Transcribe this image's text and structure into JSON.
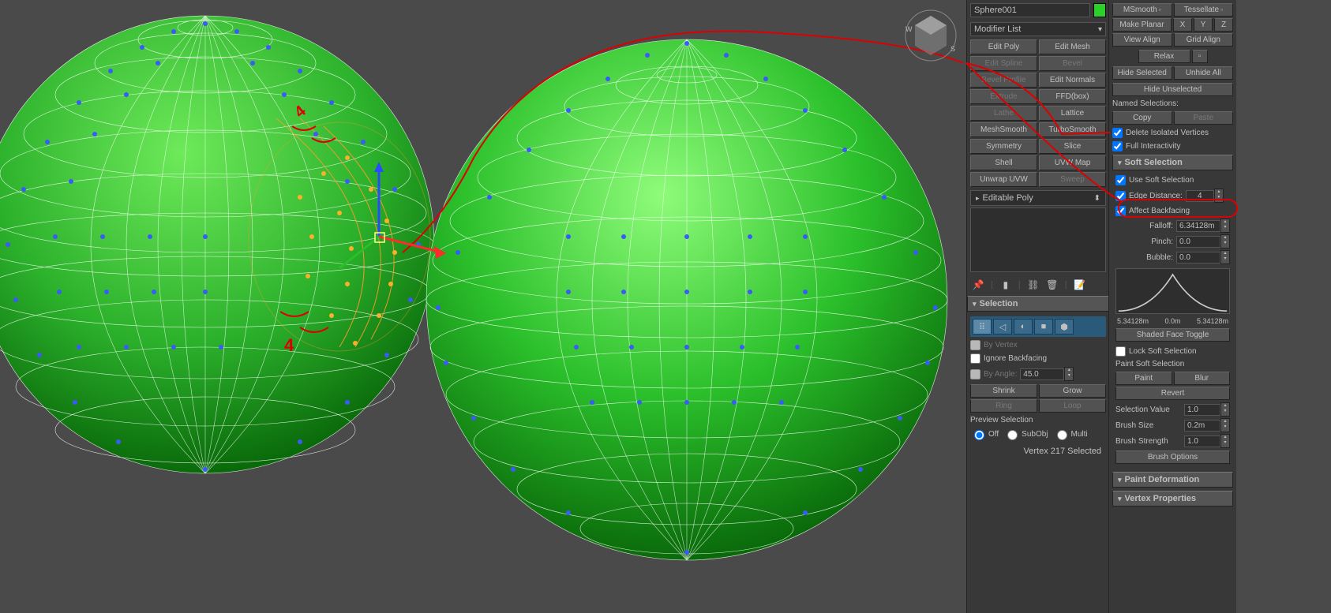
{
  "object_name": "Sphere001",
  "modifier_list_label": "Modifier List",
  "modifier_buttons": [
    {
      "label": "Edit Poly",
      "enabled": true
    },
    {
      "label": "Edit Mesh",
      "enabled": true
    },
    {
      "label": "Edit Spline",
      "enabled": false
    },
    {
      "label": "Bevel",
      "enabled": false
    },
    {
      "label": "Bevel Profile",
      "enabled": false
    },
    {
      "label": "Edit Normals",
      "enabled": true
    },
    {
      "label": "Extrude",
      "enabled": false
    },
    {
      "label": "FFD(box)",
      "enabled": true
    },
    {
      "label": "Lathe",
      "enabled": false
    },
    {
      "label": "Lattice",
      "enabled": true
    },
    {
      "label": "MeshSmooth",
      "enabled": true
    },
    {
      "label": "TurboSmooth",
      "enabled": true
    },
    {
      "label": "Symmetry",
      "enabled": true
    },
    {
      "label": "Slice",
      "enabled": true
    },
    {
      "label": "Shell",
      "enabled": true
    },
    {
      "label": "UVW Map",
      "enabled": true
    },
    {
      "label": "Unwrap UVW",
      "enabled": true
    },
    {
      "label": "Sweep",
      "enabled": false
    }
  ],
  "stack_item": "Editable Poly",
  "selection": {
    "header": "Selection",
    "by_vertex": "By Vertex",
    "ignore_backfacing": "Ignore Backfacing",
    "by_angle": "By Angle:",
    "by_angle_value": "45.0",
    "shrink": "Shrink",
    "grow": "Grow",
    "ring": "Ring",
    "loop": "Loop",
    "preview_label": "Preview Selection",
    "off": "Off",
    "subobj": "SubObj",
    "multi": "Multi",
    "status": "Vertex 217 Selected"
  },
  "right_top": {
    "msmooth": "MSmooth",
    "tessellate": "Tessellate",
    "make_planar": "Make Planar",
    "x": "X",
    "y": "Y",
    "z": "Z",
    "view_align": "View Align",
    "grid_align": "Grid Align",
    "relax": "Relax",
    "hide_selected": "Hide Selected",
    "unhide_all": "Unhide All",
    "hide_unselected": "Hide Unselected",
    "named_selections": "Named Selections:",
    "copy": "Copy",
    "paste": "Paste",
    "delete_iso": "Delete Isolated Vertices",
    "full_interactivity": "Full Interactivity"
  },
  "soft_selection": {
    "header": "Soft Selection",
    "use_soft": "Use Soft Selection",
    "edge_distance": "Edge Distance:",
    "edge_distance_value": "4",
    "affect_backfacing": "Affect Backfacing",
    "falloff_label": "Falloff:",
    "falloff_value": "6.34128m",
    "pinch_label": "Pinch:",
    "pinch_value": "0.0",
    "bubble_label": "Bubble:",
    "bubble_value": "0.0",
    "range_left": "5.34128m",
    "range_mid": "0.0m",
    "range_right": "5.34128m",
    "shaded_face_toggle": "Shaded Face Toggle",
    "lock_soft": "Lock Soft Selection",
    "paint_soft": "Paint Soft Selection",
    "paint": "Paint",
    "blur": "Blur",
    "revert": "Revert",
    "sel_value_label": "Selection Value",
    "sel_value": "1.0",
    "brush_size_label": "Brush Size",
    "brush_size": "0.2m",
    "brush_strength_label": "Brush Strength",
    "brush_strength": "1.0",
    "brush_options": "Brush Options"
  },
  "paint_deformation_header": "Paint Deformation",
  "vertex_properties_header": "Vertex Properties"
}
